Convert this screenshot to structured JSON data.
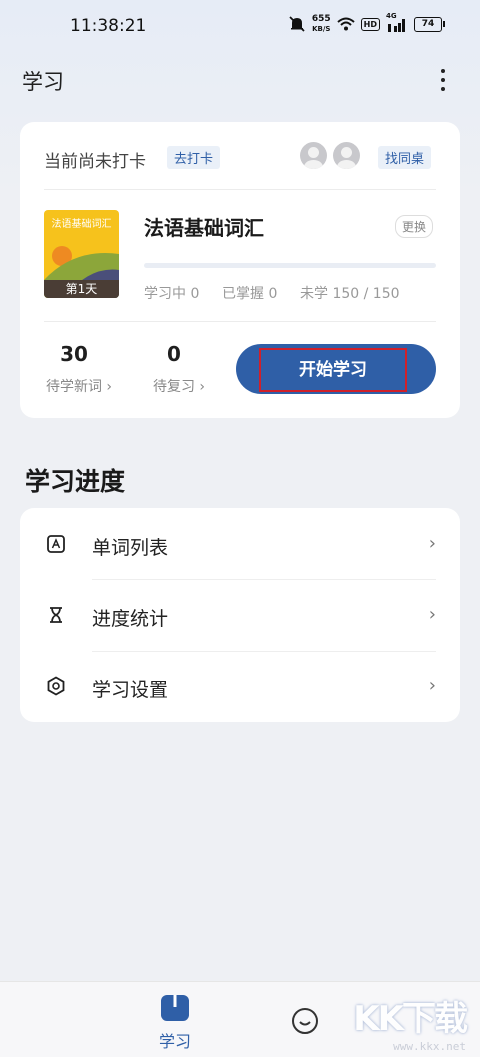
{
  "status_bar": {
    "time": "11:38:21",
    "net_speed_value": "655",
    "net_speed_unit": "KB/S",
    "hd_badge": "HD",
    "network_type": "4G",
    "battery": "74"
  },
  "header": {
    "title": "学习"
  },
  "checkin": {
    "status_text": "当前尚未打卡",
    "checkin_button": "去打卡",
    "find_deskmate_button": "找同桌"
  },
  "book": {
    "cover_title": "法语基础词汇",
    "cover_day": "第1天",
    "title": "法语基础词汇",
    "swap_button": "更换",
    "progress_fraction": 0,
    "learning": "学习中 0",
    "mastered": "已掌握 0",
    "unlearned": "未学 150 / 150"
  },
  "counters": {
    "new_words_count": "30",
    "new_words_label": "待学新词 ›",
    "review_count": "0",
    "review_label": "待复习 ›"
  },
  "start_button": "开始学习",
  "progress_section": {
    "title": "学习进度",
    "items": [
      {
        "label": "单词列表",
        "icon": "letter-a-icon"
      },
      {
        "label": "进度统计",
        "icon": "hourglass-icon"
      },
      {
        "label": "学习设置",
        "icon": "hexagon-settings-icon"
      }
    ],
    "chevron": "›"
  },
  "tabbar": {
    "study_label": "学习"
  },
  "watermark": {
    "logo": "KK下载",
    "url": "www.kkx.net"
  },
  "colors": {
    "accent": "#2f5fa7",
    "highlight_border": "#d0202a",
    "cover_yellow": "#f6c21c"
  }
}
